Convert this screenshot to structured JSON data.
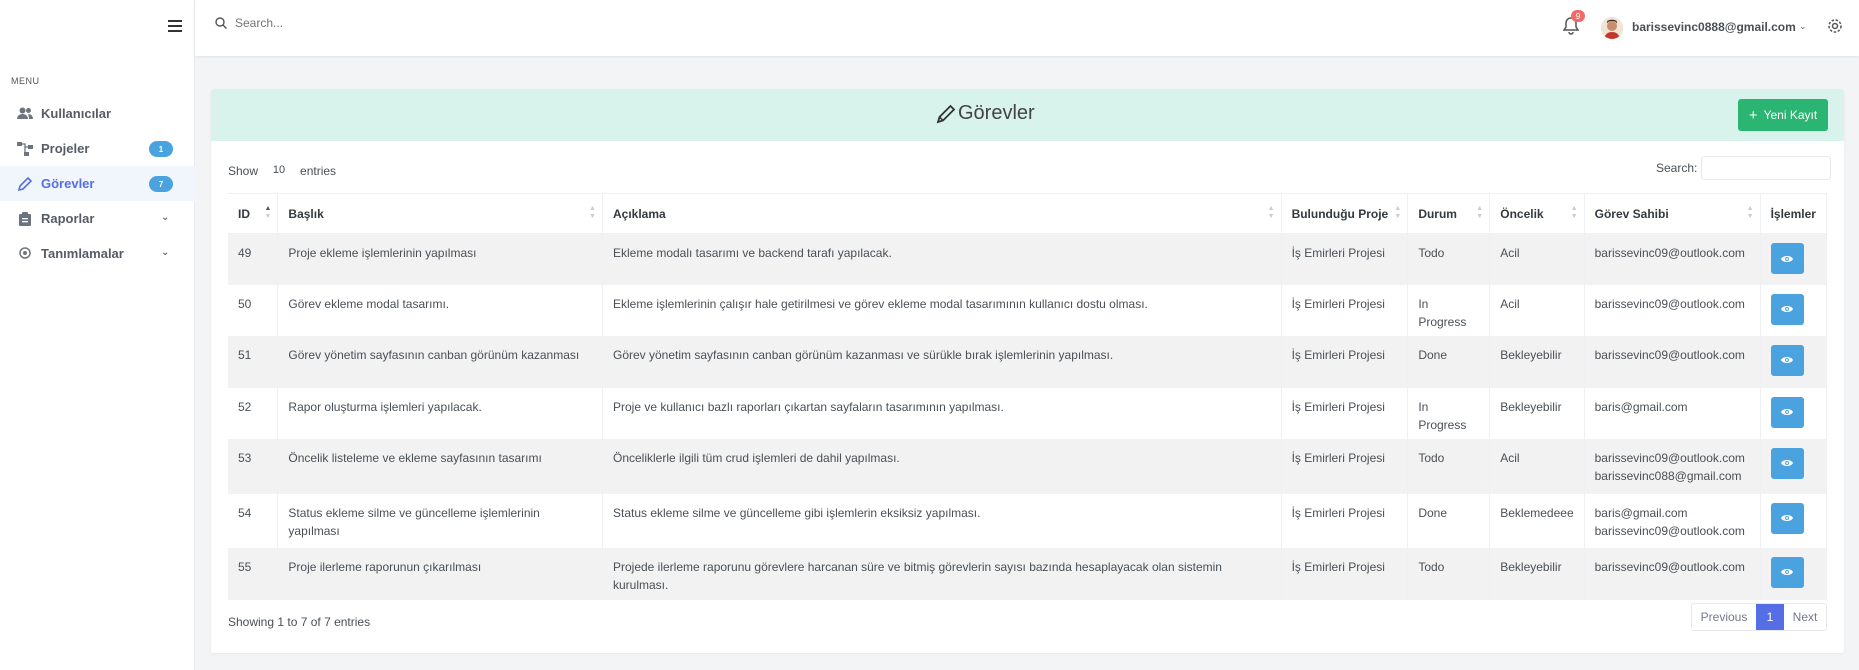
{
  "topbar": {
    "search_placeholder": "Search...",
    "notification_count": "9",
    "user_email": "barissevinc0888@gmail.com"
  },
  "sidebar": {
    "menu_title": "MENU",
    "items": [
      {
        "label": "Kullanıcılar",
        "icon": "users-icon"
      },
      {
        "label": "Projeler",
        "icon": "sitemap-icon",
        "badge": "1"
      },
      {
        "label": "Görevler",
        "icon": "pencil-icon",
        "badge": "7",
        "active": true
      },
      {
        "label": "Raporlar",
        "icon": "clipboard-icon",
        "chevron": true
      },
      {
        "label": "Tanımlamalar",
        "icon": "location-icon",
        "chevron": true
      }
    ]
  },
  "card": {
    "title": "Görevler",
    "new_button": "Yeni Kayıt",
    "show_label": "Show",
    "entries_value": "10",
    "entries_label": "entries",
    "search_label": "Search:"
  },
  "table": {
    "headers": [
      "ID",
      "Başlık",
      "Açıklama",
      "Bulunduğu Proje",
      "Durum",
      "Öncelik",
      "Görev Sahibi",
      "İşlemler"
    ],
    "rows": [
      {
        "id": "49",
        "title": "Proje ekleme işlemlerinin yapılması",
        "desc": "Ekleme modalı tasarımı ve backend tarafı yapılacak.",
        "project": "İş Emirleri Projesi",
        "status": "Todo",
        "priority": "Acil",
        "owner1": "barissevinc09@outlook.com",
        "owner2": ""
      },
      {
        "id": "50",
        "title": "Görev ekleme modal tasarımı.",
        "desc": "Ekleme işlemlerinin çalışır hale getirilmesi ve görev ekleme modal tasarımının kullanıcı dostu olması.",
        "project": "İş Emirleri Projesi",
        "status": "In Progress",
        "priority": "Acil",
        "owner1": "barissevinc09@outlook.com",
        "owner2": ""
      },
      {
        "id": "51",
        "title": "Görev yönetim sayfasının canban görünüm kazanması",
        "desc": "Görev yönetim sayfasının canban görünüm kazanması ve sürükle bırak işlemlerinin yapılması.",
        "project": "İş Emirleri Projesi",
        "status": "Done",
        "priority": "Bekleyebilir",
        "owner1": "barissevinc09@outlook.com",
        "owner2": ""
      },
      {
        "id": "52",
        "title": "Rapor oluşturma işlemleri yapılacak.",
        "desc": "Proje ve kullanıcı bazlı raporları çıkartan sayfaların tasarımının yapılması.",
        "project": "İş Emirleri Projesi",
        "status": "In Progress",
        "priority": "Bekleyebilir",
        "owner1": "baris@gmail.com",
        "owner2": ""
      },
      {
        "id": "53",
        "title": "Öncelik listeleme ve ekleme sayfasının tasarımı",
        "desc": "Önceliklerle ilgili tüm crud işlemleri de dahil yapılması.",
        "project": "İş Emirleri Projesi",
        "status": "Todo",
        "priority": "Acil",
        "owner1": "barissevinc09@outlook.com",
        "owner2": "barissevinc088@gmail.com"
      },
      {
        "id": "54",
        "title": "Status ekleme silme ve güncelleme işlemlerinin yapılması",
        "desc": "Status ekleme silme ve güncelleme gibi işlemlerin eksiksiz yapılması.",
        "project": "İş Emirleri Projesi",
        "status": "Done",
        "priority": "Beklemedeee",
        "owner1": "baris@gmail.com",
        "owner2": "barissevinc09@outlook.com"
      },
      {
        "id": "55",
        "title": "Proje ilerleme raporunun çıkarılması",
        "desc": "Projede ilerleme raporunu görevlere harcanan süre ve bitmiş görevlerin sayısı bazında hesaplayacak olan sistemin kurulması.",
        "project": "İş Emirleri Projesi",
        "status": "Todo",
        "priority": "Bekleyebilir",
        "owner1": "barissevinc09@outlook.com",
        "owner2": ""
      }
    ]
  },
  "footer": {
    "info": "Showing 1 to 7 of 7 entries",
    "prev": "Previous",
    "current_page": "1",
    "next": "Next"
  },
  "colors": {
    "accent": "#556ee6",
    "success": "#2bb573",
    "info": "#4aa3df",
    "header_bg": "#d7f3eb"
  }
}
